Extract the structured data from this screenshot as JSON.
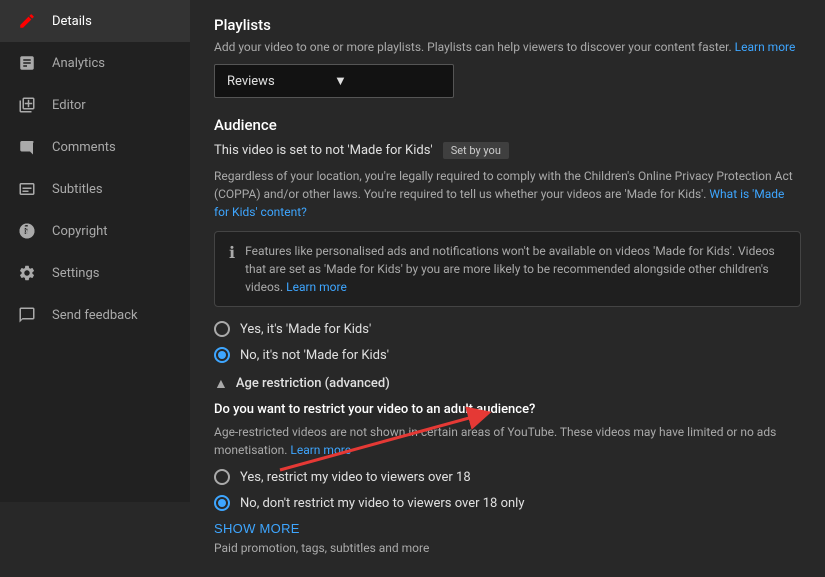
{
  "sidebar": {
    "items": [
      {
        "id": "details",
        "label": "Details",
        "icon": "✏️",
        "active": true
      },
      {
        "id": "analytics",
        "label": "Analytics",
        "icon": "📊",
        "active": false
      },
      {
        "id": "editor",
        "label": "Editor",
        "icon": "🎬",
        "active": false
      },
      {
        "id": "comments",
        "label": "Comments",
        "icon": "💬",
        "active": false
      },
      {
        "id": "subtitles",
        "label": "Subtitles",
        "icon": "📄",
        "active": false
      },
      {
        "id": "copyright",
        "label": "Copyright",
        "icon": "©",
        "active": false
      },
      {
        "id": "settings",
        "label": "Settings",
        "icon": "⚙️",
        "active": false
      },
      {
        "id": "send-feedback",
        "label": "Send feedback",
        "icon": "⚑",
        "active": false
      }
    ]
  },
  "playlists": {
    "title": "Playlists",
    "description": "Add your video to one or more playlists. Playlists can help viewers to discover your content faster.",
    "learn_more": "Learn more",
    "selected": "Reviews",
    "dropdown_arrow": "▼"
  },
  "audience": {
    "title": "Audience",
    "status_text": "This video is set to not 'Made for Kids'",
    "set_by_you": "Set by you",
    "legal_text": "Regardless of your location, you're legally required to comply with the Children's Online Privacy Protection Act (COPPA) and/or other laws. You're required to tell us whether your videos are 'Made for Kids'.",
    "what_is_link": "What is 'Made for Kids' content?",
    "info_text": "Features like personalised ads and notifications won't be available on videos 'Made for Kids'. Videos that are set as 'Made for Kids' by you are more likely to be recommended alongside other children's videos.",
    "learn_more_link": "Learn more",
    "options": [
      {
        "id": "yes-kids",
        "label": "Yes, it's 'Made for Kids'",
        "selected": false
      },
      {
        "id": "no-kids",
        "label": "No, it's not 'Made for Kids'",
        "selected": true
      }
    ]
  },
  "age_restriction": {
    "title": "Age restriction (advanced)",
    "question": "Do you want to restrict your video to an adult audience?",
    "description": "Age-restricted videos are not shown in certain areas of YouTube. These videos may have limited or no ads monetisation.",
    "learn_more": "Learn more",
    "options": [
      {
        "id": "yes-restrict",
        "label": "Yes, restrict my video to viewers over 18",
        "selected": false
      },
      {
        "id": "no-restrict",
        "label": "No, don't restrict my video to viewers over 18 only",
        "selected": true
      }
    ]
  },
  "show_more": {
    "label": "SHOW MORE",
    "desc": "Paid promotion, tags, subtitles and more"
  }
}
